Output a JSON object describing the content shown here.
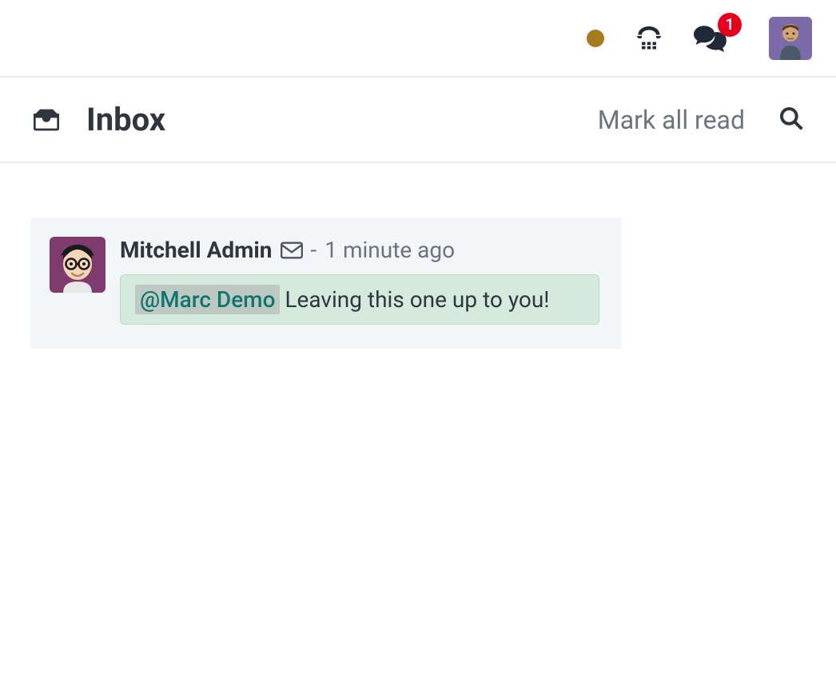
{
  "topbar": {
    "status_color": "#a67c1f",
    "notification_count": "1"
  },
  "header": {
    "title": "Inbox",
    "mark_all_read_label": "Mark all read"
  },
  "messages": [
    {
      "sender": "Mitchell Admin",
      "separator": "-",
      "time": "1 minute ago",
      "mention": "@Marc Demo",
      "body": "Leaving this one up to you!"
    }
  ]
}
